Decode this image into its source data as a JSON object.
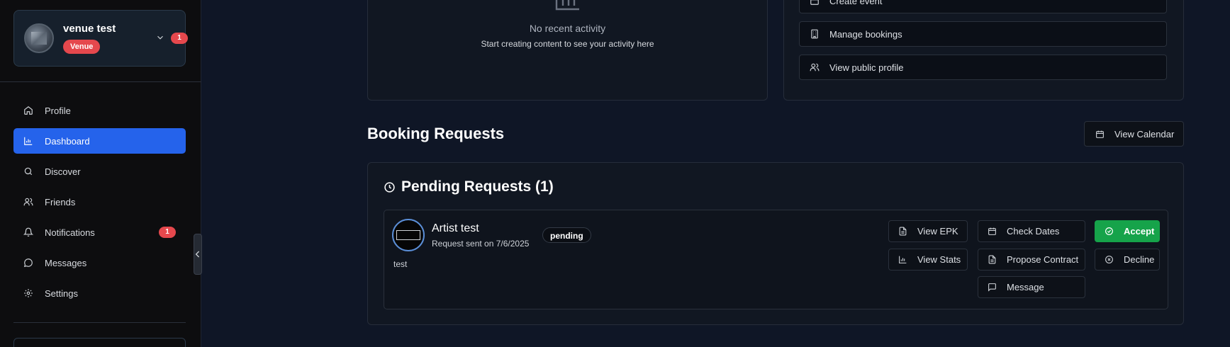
{
  "sidebar": {
    "user": {
      "name": "venue test",
      "role_badge": "Venue",
      "notification_count": "1"
    },
    "items": [
      {
        "label": "Profile",
        "icon": "home-icon"
      },
      {
        "label": "Dashboard",
        "icon": "bar-chart-icon",
        "active": true
      },
      {
        "label": "Discover",
        "icon": "search-icon"
      },
      {
        "label": "Friends",
        "icon": "users-icon"
      },
      {
        "label": "Notifications",
        "icon": "bell-icon",
        "badge": "1"
      },
      {
        "label": "Messages",
        "icon": "message-circle-icon"
      },
      {
        "label": "Settings",
        "icon": "gear-icon"
      }
    ]
  },
  "activity": {
    "title": "No recent activity",
    "subtitle": "Start creating content to see your activity here"
  },
  "quick_actions": [
    {
      "label": "Create event",
      "icon": "calendar-icon"
    },
    {
      "label": "Manage bookings",
      "icon": "building-icon"
    },
    {
      "label": "View public profile",
      "icon": "users-icon"
    }
  ],
  "booking_requests": {
    "title": "Booking Requests",
    "view_calendar_label": "View Calendar",
    "pending_title": "Pending Requests (1)",
    "requests": [
      {
        "artist_name": "Artist test",
        "sent_text": "Request sent on 7/6/2025",
        "status": "pending",
        "note": "test",
        "actions": {
          "view_epk": "View EPK",
          "view_stats": "View Stats",
          "check_dates": "Check Dates",
          "propose_contract": "Propose Contract",
          "message": "Message",
          "accept": "Accept",
          "decline": "Decline"
        }
      }
    ]
  },
  "colors": {
    "accent": "#2563eb",
    "badge": "#e5484d",
    "accept": "#16a34a",
    "background": "#0f1626"
  }
}
